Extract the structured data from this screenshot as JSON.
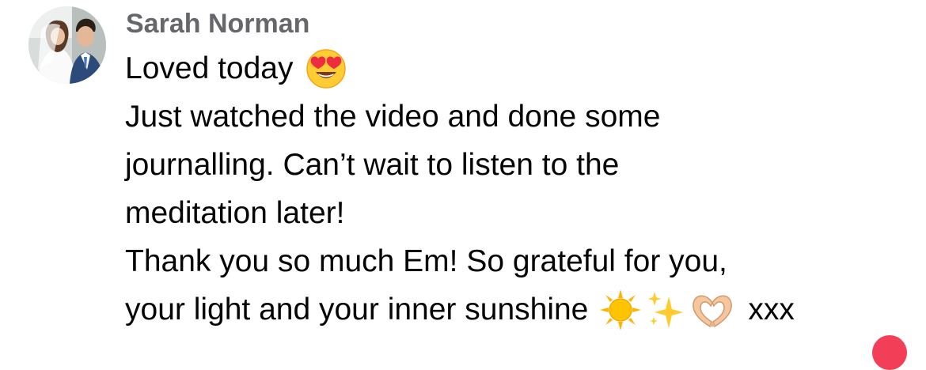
{
  "comment": {
    "author": "Sarah Norman",
    "lines": [
      "Loved today",
      "Just watched the video and done some",
      "journalling. Can’t wait to listen to the",
      "meditation later!",
      "Thank you so much Em! So grateful for you,",
      "your light and your inner sunshine",
      "xxx"
    ],
    "emojis": {
      "heart_eyes": "smiling-face-with-heart-eyes",
      "sun": "sun",
      "sparkles": "sparkles",
      "heart_hands": "heart-hands"
    }
  },
  "colors": {
    "author": "#65676b",
    "text": "#050505",
    "reaction": "#f33e58"
  }
}
